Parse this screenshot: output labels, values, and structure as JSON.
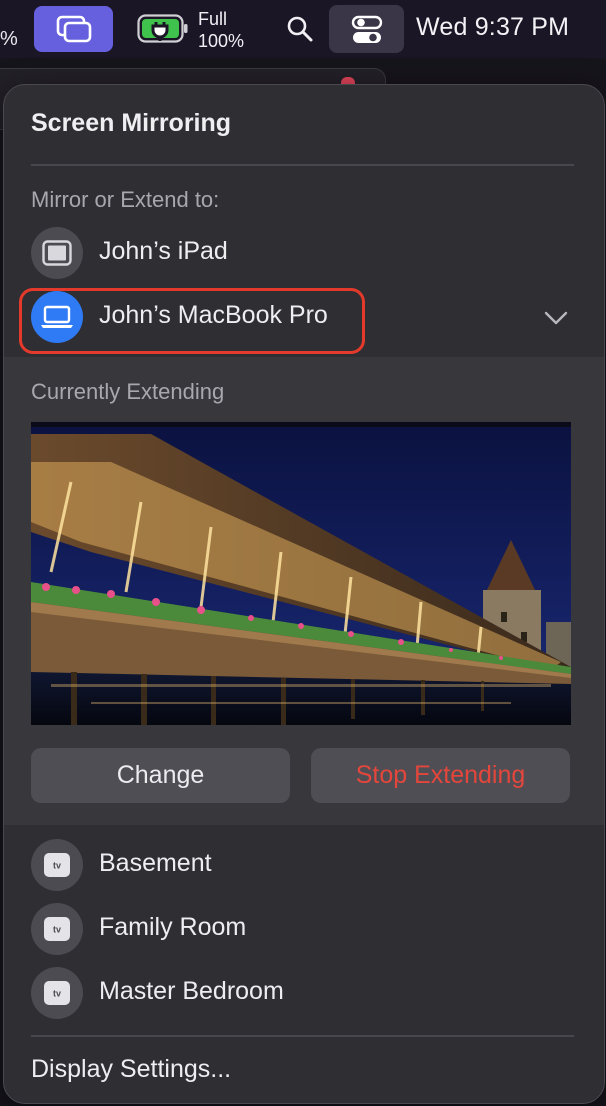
{
  "menubar": {
    "percent_fragment": "%",
    "battery_line1": "Full",
    "battery_line2": "100%",
    "clock": "Wed 9:37 PM",
    "icons": [
      "screen-mirroring-icon",
      "battery-charging-icon",
      "search-icon",
      "control-center-icon"
    ],
    "accent_color": "#6660df"
  },
  "panel": {
    "title": "Screen Mirroring",
    "mirror_label": "Mirror or Extend to:",
    "devices": [
      {
        "label": "John’s iPad",
        "icon": "ipad-icon",
        "selected": false
      },
      {
        "label": "John’s MacBook Pro",
        "icon": "laptop-icon",
        "selected": true
      }
    ],
    "extending": {
      "label": "Currently Extending",
      "change_label": "Change",
      "stop_label": "Stop Extending",
      "stop_color": "#e5463c"
    },
    "apple_tv_devices": [
      {
        "label": "Basement",
        "icon": "apple-tv-icon",
        "badge": "tv"
      },
      {
        "label": "Family Room",
        "icon": "apple-tv-icon",
        "badge": "tv"
      },
      {
        "label": "Master Bedroom",
        "icon": "apple-tv-icon",
        "badge": "tv"
      }
    ],
    "display_settings": "Display Settings..."
  }
}
